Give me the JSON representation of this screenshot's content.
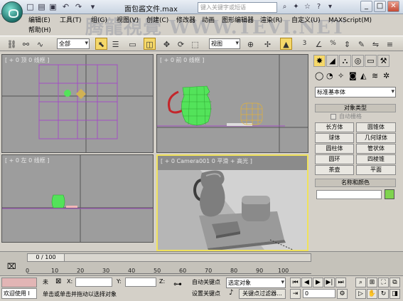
{
  "window": {
    "title": "面包酱文件.max",
    "search_placeholder": "键入关键字或短语"
  },
  "menubar": {
    "items": [
      "编辑(E)",
      "工具(T)",
      "组(G)",
      "视图(V)",
      "创建(C)",
      "修改器",
      "动画",
      "图形编辑器",
      "渲染(R)",
      "自定义(U)",
      "MAXScript(M)",
      "帮助(H)"
    ]
  },
  "watermark": "腾龍視覺 WWW.TEVI.NET",
  "toolbar": {
    "selection_filter": "全部",
    "reference_coord": "视图",
    "snap_labels": [
      "3",
      "%"
    ]
  },
  "viewports": {
    "top_label": "[ + 0 顶 0 线框 ]",
    "front_label": "[ + 0 前 0 线框 ]",
    "left_label": "[ + 0 左 0 线框 ]",
    "persp_label": "[ + 0 Camera001 0 平滑 + 高光 ]"
  },
  "command_panel": {
    "category_dropdown": "标准基本体",
    "object_type_header": "对象类型",
    "autogrid_label": "自动栅格",
    "buttons": [
      "长方体",
      "圆锥体",
      "球体",
      "几何球体",
      "圆柱体",
      "管状体",
      "圆环",
      "四棱锥",
      "茶壶",
      "平面"
    ],
    "name_color_header": "名称和颜色",
    "swatch_color": "#7fd34e"
  },
  "timeline": {
    "frame_display": "0 / 100",
    "ticks": [
      "0",
      "10",
      "20",
      "30",
      "40",
      "50",
      "60",
      "70",
      "80",
      "90",
      "100"
    ]
  },
  "status": {
    "welcome": "欢迎使用 I",
    "selection_state": "未",
    "x_label": "X:",
    "y_label": "Y:",
    "z_label": "Z:",
    "prompt": "单击或单击并拖动以选择对象",
    "auto_key": "自动关键点",
    "set_key": "设置关键点",
    "selected_object": "选定对象",
    "key_filter": "关键点过滤器...",
    "frame_value": "0"
  },
  "colors": {
    "accent_selected_viewport": "#f0e25c",
    "teapot_green": "#53e35a",
    "teapot_handle": "#c3262b",
    "grid_purple": "#a24fc2"
  }
}
